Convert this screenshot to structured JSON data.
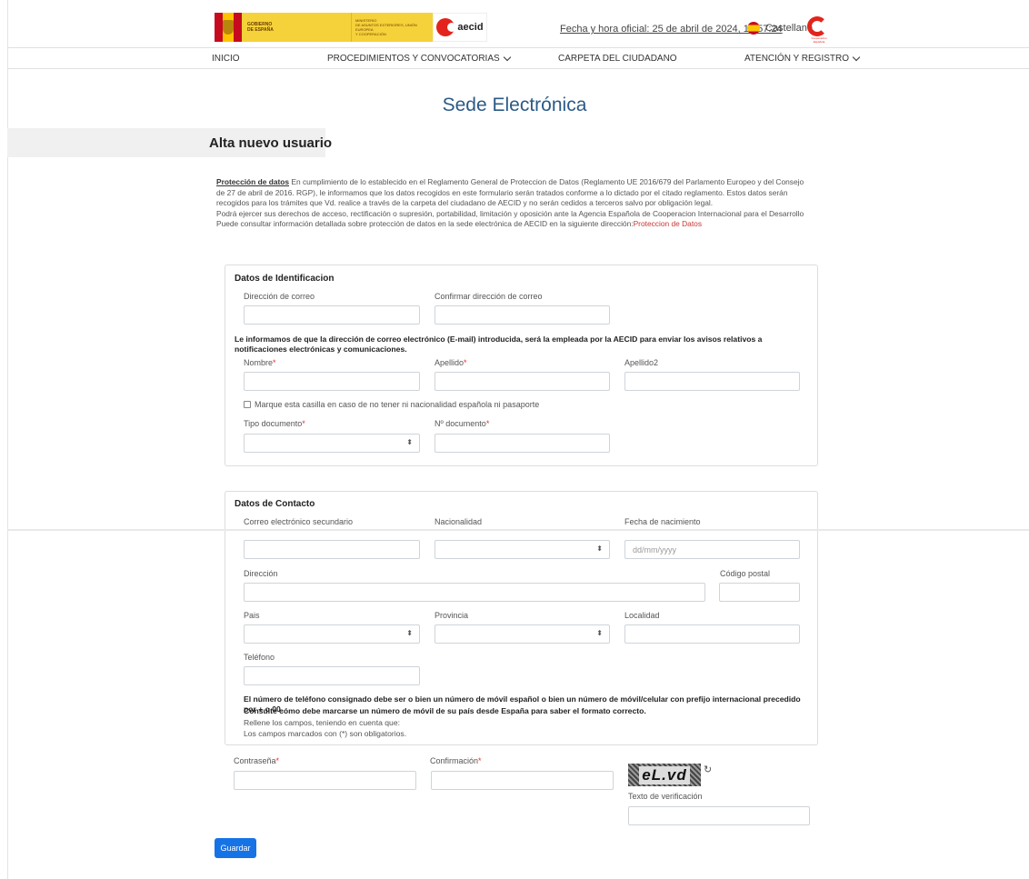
{
  "header": {
    "gov_logo_text": [
      "GOBIERNO",
      "DE ESPAÑA"
    ],
    "ministry_text": [
      "MINISTERIO",
      "DE ASUNTOS EXTERIORES, UNIÓN EUROPEA",
      "Y COOPERACIÓN"
    ],
    "aecid_text": "aecid",
    "fecha": "Fecha y hora oficial: 25 de abril de 2024, 17:57:24",
    "language": "Castellano",
    "coop_text": "Cooperación Española"
  },
  "nav": {
    "items": [
      {
        "label": "INICIO"
      },
      {
        "label": "PROCEDIMIENTOS Y CONVOCATORIAS"
      },
      {
        "label": "CARPETA DEL CIUDADANO"
      },
      {
        "label": "ATENCIÓN Y REGISTRO"
      }
    ]
  },
  "page": {
    "title": "Sede Electrónica",
    "subtitle": "Alta nuevo usuario"
  },
  "privacy": {
    "title": "Protección de datos",
    "body": " En cumplimiento de lo establecido en el Reglamento General de Proteccion de Datos (Reglamento UE 2016/679 del Parlamento Europeo y del Consejo de 27 de abril de 2016. RGP), le informamos que los datos recogidos en este formulario serán tratados conforme a lo dictado por el citado reglamento. Estos datos serán recogidos para los trámites que Vd. realice a través de la carpeta del ciudadano de AECID y no serán cedidos a terceros salvo por obligación legal.",
    "rights": "Podrá ejercer sus derechos de acceso, rectificación o supresión, portabilidad, limitación y oposición ante la Agencia Española de Cooperacion Internacional para el Desarrollo",
    "consult": "Puede consultar información detallada sobre protección de datos en la sede electrónica de AECID en la siguiente dirección:",
    "link": "Proteccion de Datos"
  },
  "identificacion": {
    "title": "Datos de Identificacion",
    "email_label": "Dirección de correo",
    "email_confirm_label": "Confirmar dirección de correo",
    "email_note": "Le informamos de que la dirección de correo electrónico (E-mail) introducida, será la empleada por la AECID para enviar los avisos relativos a notificaciones electrónicas y comunicaciones.",
    "nombre_label": "Nombre",
    "apellido_label": "Apellido",
    "apellido2_label": "Apellido2",
    "checkbox_label": "Marque esta casilla en caso de no tener ni nacionalidad española ni pasaporte",
    "tipo_doc_label": "Tipo documento",
    "num_doc_label": "Nº documento",
    "required_mark": "*"
  },
  "contacto": {
    "title": "Datos de Contacto",
    "correo_sec_label": "Correo electrónico secundario",
    "nacionalidad_label": "Nacionalidad",
    "fecha_nac_label": "Fecha de nacimiento",
    "fecha_nac_placeholder": "dd/mm/yyyy",
    "direccion_label": "Dirección",
    "cp_label": "Código postal",
    "pais_label": "Pais",
    "provincia_label": "Provincia",
    "localidad_label": "Localidad",
    "telefono_label": "Teléfono",
    "tel_note": "El número de teléfono consignado debe ser o bien un número de móvil español o bien un número de móvil/celular con prefijo internacional precedido por + o 00.",
    "tel_note2": "Consulte cómo debe marcarse un número de móvil de su país desde España para saber el formato correcto.",
    "fill_note": "Rellene los campos, teniendo en cuenta que:",
    "required_note": "Los campos marcados con (*) son obligatorios."
  },
  "auth": {
    "password_label": "Contraseña",
    "confirm_label": "Confirmación",
    "captcha_text": "eL.vd",
    "refresh_icon": "↻",
    "verif_label": "Texto de verificación"
  },
  "actions": {
    "save_label": "Guardar"
  },
  "colors": {
    "title_blue": "#2b5a86",
    "button_blue": "#1673e6",
    "required_red": "#d33",
    "aecid_red": "#e2241c"
  }
}
